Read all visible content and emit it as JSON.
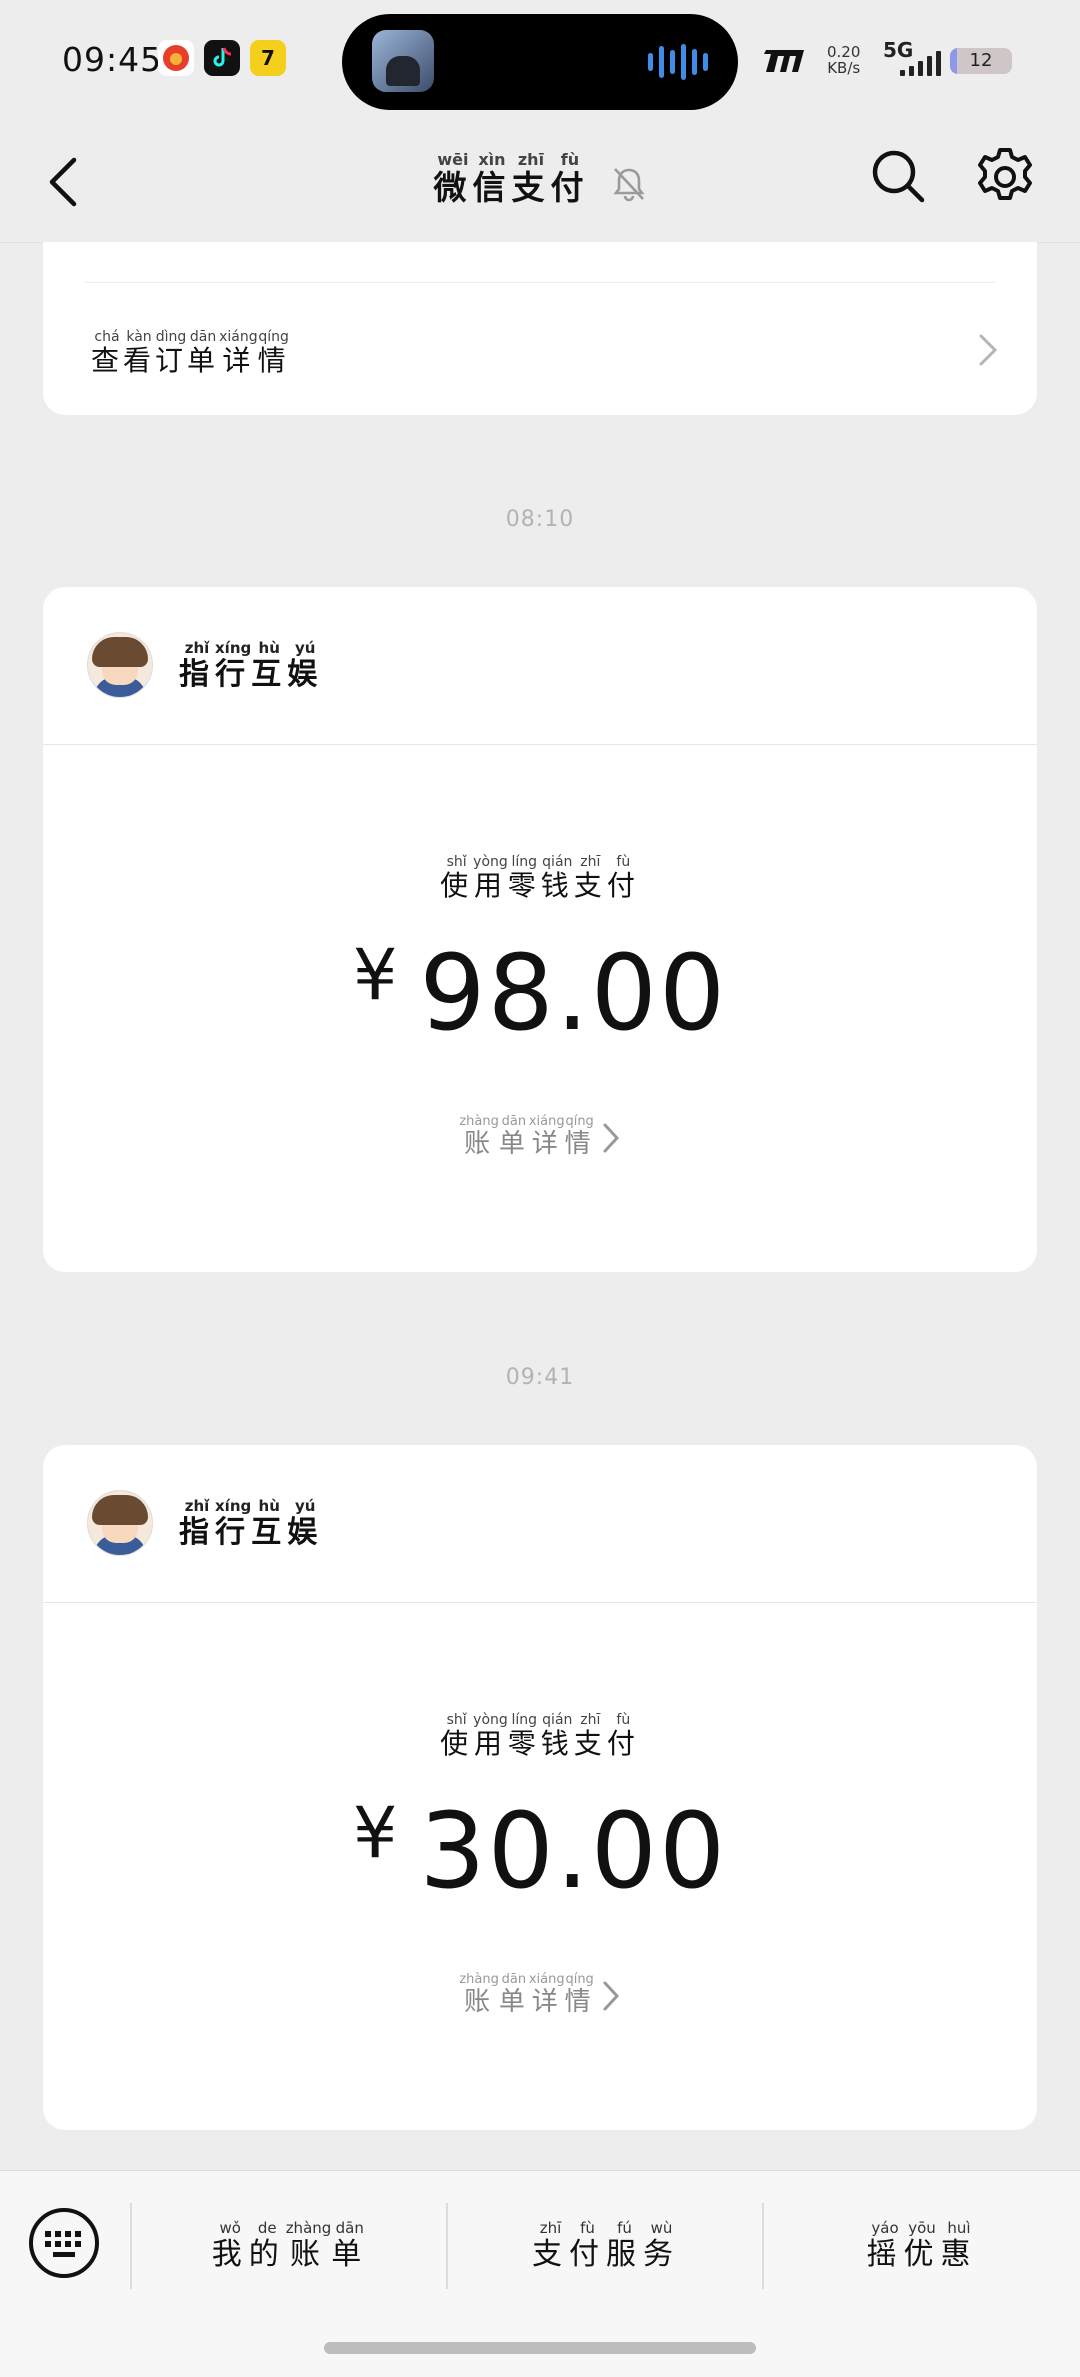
{
  "status_bar": {
    "time": "09:45",
    "net_speed_value": "0.20",
    "net_speed_unit": "KB/s",
    "network": "5G",
    "battery": "12",
    "battery_level": 0.12,
    "app_icons": [
      "weibo-icon",
      "tiktok-icon",
      "qimao-icon"
    ]
  },
  "header": {
    "title": [
      {
        "char": "微",
        "pinyin": "wēi"
      },
      {
        "char": "信",
        "pinyin": "xìn"
      },
      {
        "char": "支",
        "pinyin": "zhī"
      },
      {
        "char": "付",
        "pinyin": "fù"
      }
    ]
  },
  "top_card": {
    "link": [
      {
        "char": "查",
        "pinyin": "chá"
      },
      {
        "char": "看",
        "pinyin": "kàn"
      },
      {
        "char": "订",
        "pinyin": "dìng"
      },
      {
        "char": "单",
        "pinyin": "dān"
      },
      {
        "char": "详",
        "pinyin": "xiáng"
      },
      {
        "char": "情",
        "pinyin": "qíng"
      }
    ]
  },
  "messages": [
    {
      "time": "08:10",
      "merchant": [
        {
          "char": "指",
          "pinyin": "zhǐ"
        },
        {
          "char": "行",
          "pinyin": "xíng"
        },
        {
          "char": "互",
          "pinyin": "hù"
        },
        {
          "char": "娱",
          "pinyin": "yú"
        }
      ],
      "method": [
        {
          "char": "使",
          "pinyin": "shǐ"
        },
        {
          "char": "用",
          "pinyin": "yòng"
        },
        {
          "char": "零",
          "pinyin": "líng"
        },
        {
          "char": "钱",
          "pinyin": "qián"
        },
        {
          "char": "支",
          "pinyin": "zhī"
        },
        {
          "char": "付",
          "pinyin": "fù"
        }
      ],
      "currency": "¥",
      "amount": "98.00",
      "bill": [
        {
          "char": "账",
          "pinyin": "zhàng"
        },
        {
          "char": "单",
          "pinyin": "dān"
        },
        {
          "char": "详",
          "pinyin": "xiáng"
        },
        {
          "char": "情",
          "pinyin": "qíng"
        }
      ]
    },
    {
      "time": "09:41",
      "merchant": [
        {
          "char": "指",
          "pinyin": "zhǐ"
        },
        {
          "char": "行",
          "pinyin": "xíng"
        },
        {
          "char": "互",
          "pinyin": "hù"
        },
        {
          "char": "娱",
          "pinyin": "yú"
        }
      ],
      "method": [
        {
          "char": "使",
          "pinyin": "shǐ"
        },
        {
          "char": "用",
          "pinyin": "yòng"
        },
        {
          "char": "零",
          "pinyin": "líng"
        },
        {
          "char": "钱",
          "pinyin": "qián"
        },
        {
          "char": "支",
          "pinyin": "zhī"
        },
        {
          "char": "付",
          "pinyin": "fù"
        }
      ],
      "currency": "¥",
      "amount": "30.00",
      "bill": [
        {
          "char": "账",
          "pinyin": "zhàng"
        },
        {
          "char": "单",
          "pinyin": "dān"
        },
        {
          "char": "详",
          "pinyin": "xiáng"
        },
        {
          "char": "情",
          "pinyin": "qíng"
        }
      ]
    }
  ],
  "bottom_menu": [
    [
      {
        "char": "我",
        "pinyin": "wǒ"
      },
      {
        "char": "的",
        "pinyin": "de"
      },
      {
        "char": "账",
        "pinyin": "zhàng"
      },
      {
        "char": "单",
        "pinyin": "dān"
      }
    ],
    [
      {
        "char": "支",
        "pinyin": "zhī"
      },
      {
        "char": "付",
        "pinyin": "fù"
      },
      {
        "char": "服",
        "pinyin": "fú"
      },
      {
        "char": "务",
        "pinyin": "wù"
      }
    ],
    [
      {
        "char": "摇",
        "pinyin": "yáo"
      },
      {
        "char": "优",
        "pinyin": "yōu"
      },
      {
        "char": "惠",
        "pinyin": "huì"
      }
    ]
  ],
  "colors": {
    "background": "#ededed",
    "card": "#ffffff",
    "time_label": "#b3b3b3",
    "wave": "#3f8de6"
  }
}
